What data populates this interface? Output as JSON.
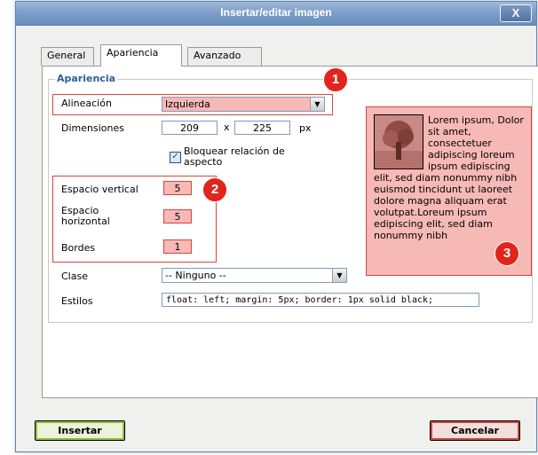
{
  "dialog": {
    "title": "Insertar/editar imagen",
    "close_label": "X"
  },
  "tabs": [
    {
      "label": "General",
      "active": false
    },
    {
      "label": "Apariencia",
      "active": true
    },
    {
      "label": "Avanzado",
      "active": false
    }
  ],
  "appearance": {
    "legend": "Apariencia",
    "align_label": "Alineación",
    "align_value": "Izquierda",
    "dimensions_label": "Dimensiones",
    "width_value": "209",
    "times": "x",
    "height_value": "225",
    "unit": "px",
    "lock_label": "Bloquear relación de aspecto",
    "lock_checked": true,
    "vspace_label": "Espacio vertical",
    "vspace_value": "5",
    "hspace_label": "Espacio horizontal",
    "hspace_value": "5",
    "border_label": "Bordes",
    "border_value": "1",
    "class_label": "Clase",
    "class_value": "-- Ninguno --",
    "style_label": "Estilos",
    "style_value": "float: left; margin: 5px; border: 1px solid black;"
  },
  "preview": {
    "text": "Lorem ipsum, Dolor sit amet, consectetuer adipiscing loreum ipsum edipiscing elit, sed diam nonummy nibh euismod tincidunt ut laoreet dolore magna aliquam erat volutpat.Loreum ipsum edipiscing elit, sed diam nonummy nibh"
  },
  "badges": [
    "1",
    "2",
    "3"
  ],
  "buttons": {
    "insert": "Insertar",
    "cancel": "Cancelar"
  },
  "colors": {
    "highlight": "#f6b9b6",
    "highlight_border": "#d9443f",
    "badge": "#e0251c",
    "title_bar": "#7b9dc8"
  }
}
